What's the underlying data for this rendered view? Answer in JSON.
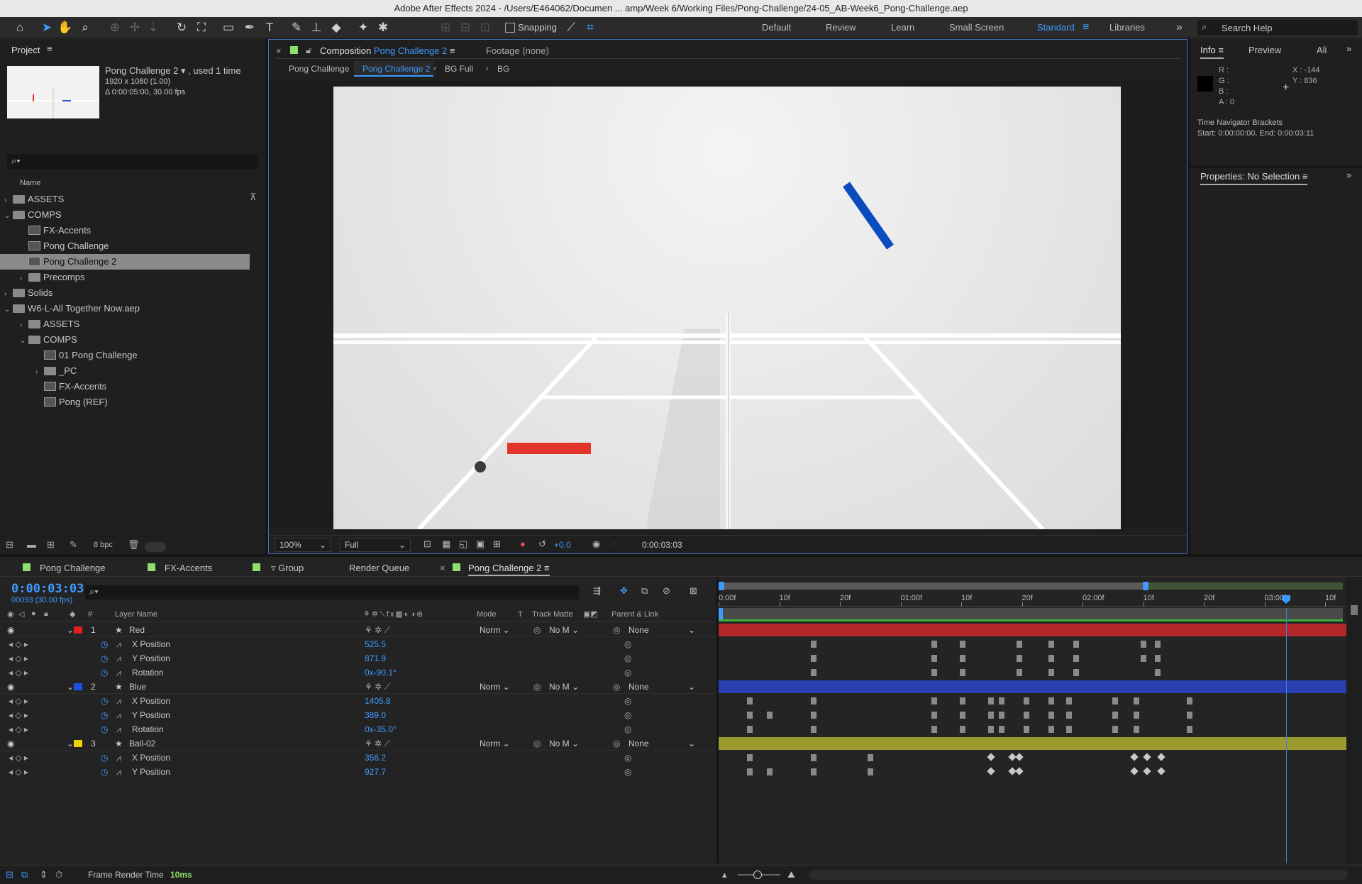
{
  "window_title": "Adobe After Effects 2024 - /Users/E464062/Documen ... amp/Week 6/Working Files/Pong-Challenge/24-05_AB-Week6_Pong-Challenge.aep",
  "toolbar": {
    "snapping_label": "Snapping",
    "workspaces": [
      "Default",
      "Review",
      "Learn",
      "Small Screen",
      "Standard",
      "Libraries"
    ],
    "active_workspace": "Standard",
    "search_help_placeholder": "Search Help"
  },
  "project": {
    "tab_label": "Project",
    "item_name": "Pong Challenge 2",
    "used": ", used 1 time",
    "dims": "1920 x 1080 (1.00)",
    "duration": "Δ 0:00:05:00, 30.00 fps",
    "column_name": "Name",
    "bpc": "8 bpc",
    "tree": [
      {
        "label": "ASSETS",
        "type": "folder",
        "level": 0,
        "twirl": "closed"
      },
      {
        "label": "COMPS",
        "type": "folder",
        "level": 0,
        "twirl": "open"
      },
      {
        "label": "FX-Accents",
        "type": "comp",
        "level": 1,
        "twirl": ""
      },
      {
        "label": "Pong Challenge",
        "type": "comp",
        "level": 1,
        "twirl": ""
      },
      {
        "label": "Pong Challenge 2",
        "type": "comp",
        "level": 1,
        "twirl": "",
        "selected": true
      },
      {
        "label": "Precomps",
        "type": "folder",
        "level": 1,
        "twirl": "closed"
      },
      {
        "label": "Solids",
        "type": "folder",
        "level": 0,
        "twirl": "closed"
      },
      {
        "label": "W6-L-All Together Now.aep",
        "type": "folder",
        "level": 0,
        "twirl": "open"
      },
      {
        "label": "ASSETS",
        "type": "folder",
        "level": 1,
        "twirl": "closed"
      },
      {
        "label": "COMPS",
        "type": "folder",
        "level": 1,
        "twirl": "open"
      },
      {
        "label": "01 Pong Challenge",
        "type": "comp",
        "level": 2,
        "twirl": ""
      },
      {
        "label": "_PC",
        "type": "folder",
        "level": 2,
        "twirl": "closed"
      },
      {
        "label": "FX-Accents",
        "type": "comp",
        "level": 2,
        "twirl": ""
      },
      {
        "label": "Pong (REF)",
        "type": "comp",
        "level": 2,
        "twirl": ""
      }
    ]
  },
  "composition": {
    "tab_prefix": "Composition",
    "tab_name": "Pong Challenge 2",
    "footage_tab": "Footage (none)",
    "breadcrumbs": [
      "Pong Challenge",
      "Pong Challenge 2",
      "BG Full",
      "BG"
    ],
    "zoom": "100%",
    "resolution": "Full",
    "exposure": "+0.0",
    "timecode": "0:00:03:03"
  },
  "info": {
    "tabs": [
      "Info",
      "Preview",
      "Ali"
    ],
    "r": "R :",
    "g": "G :",
    "b": "B :",
    "a": "A :  0",
    "x": "X : -144",
    "y": "Y : 836",
    "nav_title": "Time Navigator Brackets",
    "nav_range": "Start: 0:00:00:00, End: 0:00:03:11",
    "properties_tab": "Properties: No Selection"
  },
  "timeline": {
    "tabs": [
      "Pong Challenge",
      "FX-Accents",
      "▿ Group",
      "Render Queue",
      "Pong Challenge 2"
    ],
    "current_time": "0:00:03:03",
    "frame_info": "00093 (30.00 fps)",
    "columns": {
      "num": "#",
      "layer_name": "Layer Name",
      "mode": "Mode",
      "t": "T",
      "track_matte": "Track Matte",
      "parent": "Parent & Link"
    },
    "ruler": [
      "0:00f",
      "10f",
      "20f",
      "01:00f",
      "10f",
      "20f",
      "02:00f",
      "10f",
      "20f",
      "03:00f",
      "10f"
    ],
    "layers": [
      {
        "num": "1",
        "name": "Red",
        "color": "#e02020",
        "mode": "Norm",
        "matte": "No M",
        "parent": "None",
        "props": [
          {
            "name": "X Position",
            "value": "525.5"
          },
          {
            "name": "Y Position",
            "value": "871.9"
          },
          {
            "name": "Rotation",
            "value": "0x-90.1°"
          }
        ]
      },
      {
        "num": "2",
        "name": "Blue",
        "color": "#1e4fe0",
        "mode": "Norm",
        "matte": "No M",
        "parent": "None",
        "props": [
          {
            "name": "X Position",
            "value": "1405.8"
          },
          {
            "name": "Y Position",
            "value": "389.0"
          },
          {
            "name": "Rotation",
            "value": "0x-35.0°"
          }
        ]
      },
      {
        "num": "3",
        "name": "Ball-02",
        "color": "#e8d400",
        "mode": "Norm",
        "matte": "No M",
        "parent": "None",
        "props": [
          {
            "name": "X Position",
            "value": "356.2"
          },
          {
            "name": "Y Position",
            "value": "927.7"
          }
        ]
      }
    ],
    "footer_label": "Frame Render Time",
    "footer_value": "10ms"
  }
}
